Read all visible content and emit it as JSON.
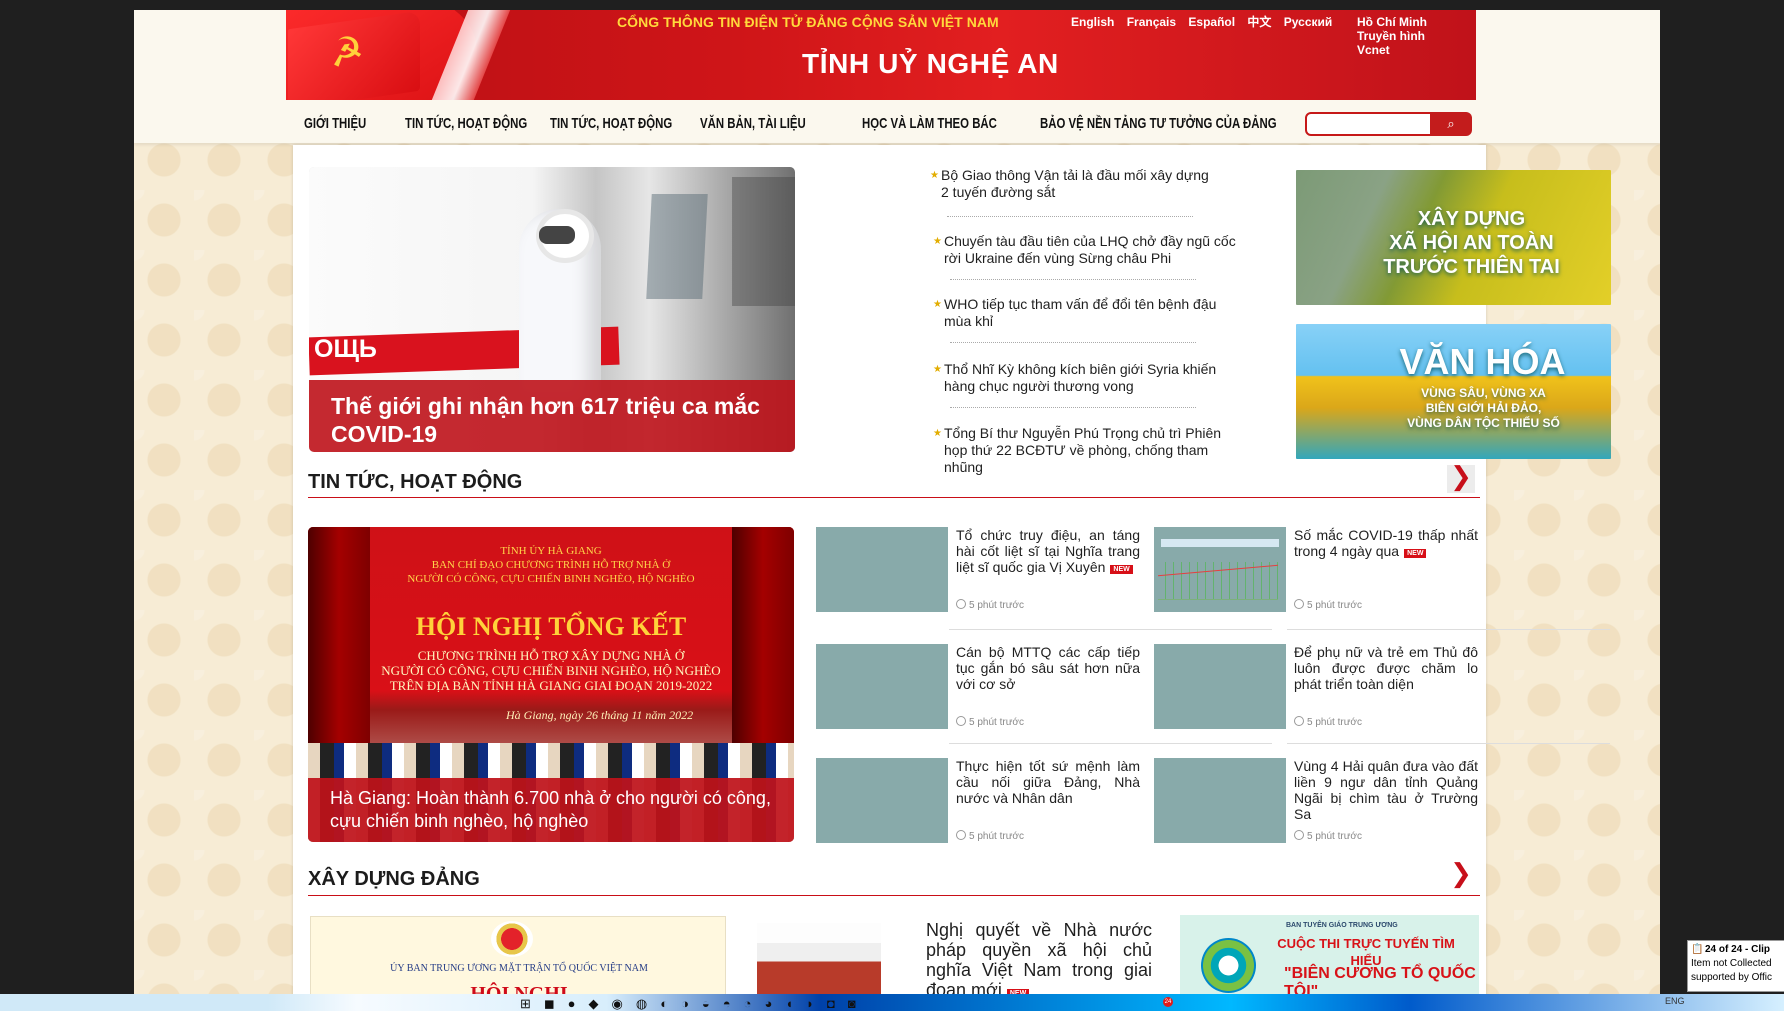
{
  "header": {
    "portal": "CỔNG THÔNG TIN ĐIỆN TỬ ĐẢNG CỘNG SẢN VIỆT NAM",
    "languages": [
      "English",
      "Français",
      "Español",
      "中文",
      "Русский"
    ],
    "quick_links": [
      "Hồ Chí Minh",
      "Truyền hình",
      "Vcnet"
    ],
    "province": "TỈNH UỶ NGHỆ AN",
    "nav": [
      "GIỚI THIỆU",
      "TIN TỨC, HOẠT ĐỘNG",
      "TIN TỨC, HOẠT ĐỘNG",
      "VĂN BẢN, TÀI LIỆU",
      "HỌC VÀ LÀM THEO BÁC",
      "BẢO VỆ NỀN TẢNG TƯ TƯỞNG CỦA ĐẢNG"
    ]
  },
  "search": {
    "value": ""
  },
  "top": {
    "feature": {
      "title": "Thế giới ghi nhận hơn 617 triệu ca mắc COVID-19",
      "vehicle": "ОЩЬ"
    },
    "ticker": [
      "Bộ Giao thông Vận tải là đầu mối xây dựng 2 tuyến đường sắt",
      "Chuyến tàu đầu tiên của LHQ chở đầy ngũ cốc rời Ukraine đến vùng Sừng châu Phi",
      "WHO tiếp tục tham vấn để đổi tên bệnh đậu mùa khỉ",
      "Thổ Nhĩ Kỳ không kích biên giới Syria khiến hàng chục người thương vong",
      "Tổng Bí thư Nguyễn Phú Trọng chủ trì Phiên họp thứ 22 BCĐTƯ về phòng, chống tham nhũng"
    ],
    "ads": [
      {
        "lines": [
          "XÂY DỰNG",
          "XÃ HỘI AN TOÀN",
          "TRƯỚC THIÊN TAI"
        ]
      },
      {
        "lines": [
          "VĂN HÓA",
          "VÙNG SÂU, VÙNG XA",
          "BIÊN GIỚI HẢI ĐẢO,",
          "VÙNG DÂN TỘC THIỂU SỐ"
        ]
      }
    ]
  },
  "section_news": {
    "title": "TIN TỨC, HOẠT ĐỘNG",
    "arrow": "❯",
    "featured": {
      "header": [
        "TỈNH ỦY HÀ GIANG",
        "BAN CHỈ ĐẠO CHƯƠNG TRÌNH HỖ TRỢ NHÀ Ở",
        "NGƯỜI CÓ CÔNG, CỰU CHIẾN BINH NGHÈO, HỘ NGHÈO"
      ],
      "banner": "HỘI NGHỊ TỔNG KẾT",
      "lines": [
        "CHƯƠNG TRÌNH HỖ TRỢ XÂY DỰNG NHÀ Ở",
        "NGƯỜI CÓ CÔNG, CỰU CHIẾN BINH NGHÈO, HỘ NGHÈO",
        "TRÊN ĐỊA BÀN TỈNH HÀ GIANG GIAI ĐOẠN 2019-2022"
      ],
      "date": "Hà Giang, ngày 26 tháng 11 năm 2022",
      "caption": "Hà Giang: Hoàn thành 6.700 nhà ở cho người có công, cựu chiến binh nghèo, hộ nghèo"
    },
    "new_label": "NEW",
    "cards": [
      {
        "title": "Tổ chức truy điệu, an táng hài cốt liệt sĩ tại Nghĩa trang liệt sĩ quốc gia Vị Xuyên",
        "time": "5 phút trước",
        "is_new": true
      },
      {
        "title": "Số mắc COVID-19 thấp nhất trong 4 ngày qua",
        "time": "5 phút trước",
        "is_new": true
      },
      {
        "title": "Cán bộ MTTQ các cấp tiếp tục gắn bó sâu sát hơn nữa với cơ sở",
        "time": "5 phút trước",
        "is_new": false
      },
      {
        "title": "Để phụ nữ và trẻ em Thủ đô luôn được được chăm lo phát triển toàn diện",
        "time": "5 phút trước",
        "is_new": false
      },
      {
        "title": "Thực hiện tốt sứ mệnh làm cầu nối giữa Đảng, Nhà nước và Nhân dân",
        "time": "5 phút trước",
        "is_new": false
      },
      {
        "title": "Vùng 4 Hải quân đưa vào đất liền 9 ngư dân tỉnh Quảng Ngãi bị chìm tàu ở Trường Sa",
        "time": "5 phút trước",
        "is_new": false
      }
    ]
  },
  "section_party": {
    "title": "XÂY DỰNG ĐẢNG",
    "arrow": "❯",
    "doc1": {
      "label": "ỦY BAN TRUNG ƯƠNG MẶT TRẬN TỔ QUỐC VIỆT NAM",
      "headline": "HỘI NGHỊ"
    },
    "doc2_title": "Nghị quyết về Nhà nước pháp quyền xã hội chủ nghĩa Việt Nam trong giai đoạn mới",
    "doc3": {
      "head": "BAN TUYÊN GIÁO TRUNG ƯƠNG",
      "title": "CUỘC THI TRỰC TUYẾN TÌM HIỂU",
      "subtitle": "\"BIÊN CƯƠNG TỔ QUỐC TÔI\""
    }
  },
  "desktop": {
    "notice": {
      "count": "24 of 24 - Clip",
      "line1": "Item not Collected",
      "line2": "supported by Offic"
    },
    "lang": "ENG",
    "badge": "24"
  }
}
